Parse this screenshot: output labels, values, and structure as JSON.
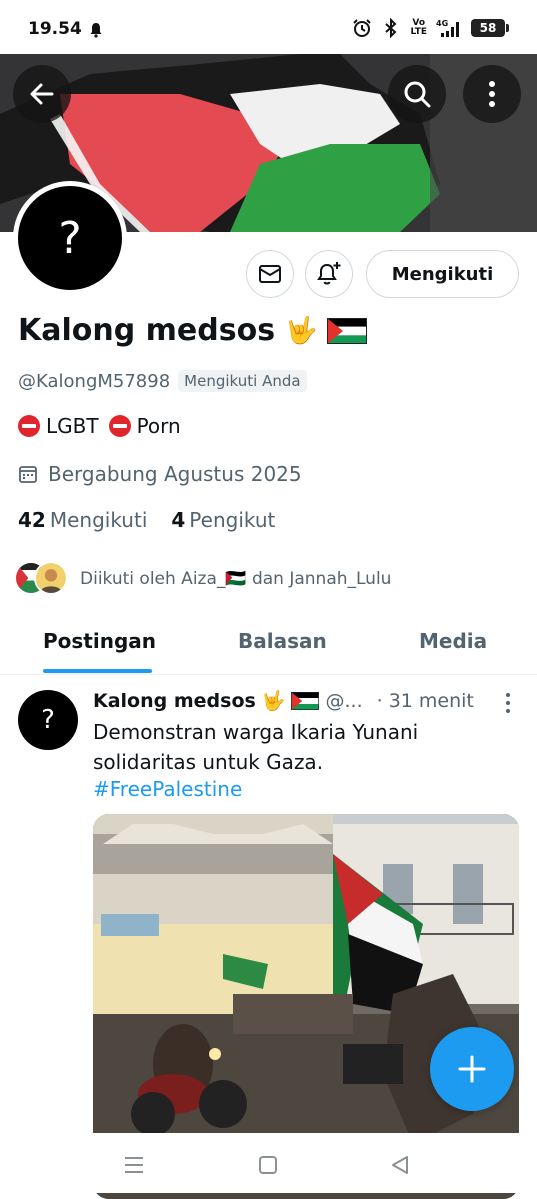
{
  "status_bar": {
    "time": "19.54",
    "volte_top": "Vo",
    "volte_bottom": "LTE",
    "network": "4G",
    "battery": "58",
    "icons": [
      "bell-icon",
      "alarm-icon",
      "bluetooth-icon",
      "volte-icon",
      "signal-icon",
      "battery-icon"
    ]
  },
  "header": {
    "back_icon": "arrow-left-icon",
    "search_icon": "search-icon",
    "more_icon": "more-vertical-icon"
  },
  "profile": {
    "avatar_glyph": "?",
    "display_name": "Kalong medsos",
    "name_emoji": "🤟",
    "handle": "@KalongM57898",
    "follows_you_badge": "Mengikuti Anda",
    "bio_part_1": "LGBT",
    "bio_part_2": "Porn",
    "joined": "Bergabung Agustus 2025",
    "following_count": "42",
    "following_label": "Mengikuti",
    "followers_count": "4",
    "followers_label": "Pengikut",
    "followed_by": "Diikuti oleh Aiza_🇵🇸 dan Jannah_Lulu"
  },
  "actions": {
    "follow_button": "Mengikuti",
    "message_icon": "mail-icon",
    "notify_icon": "bell-plus-icon"
  },
  "tabs": [
    {
      "label": "Postingan",
      "active": true
    },
    {
      "label": "Balasan",
      "active": false
    },
    {
      "label": "Media",
      "active": false
    }
  ],
  "post": {
    "author_name": "Kalong medsos",
    "author_emoji": "🤟",
    "author_handle": "@...",
    "time": "· 31 menit",
    "text": "Demonstran warga Ikaria Yunani solidaritas untuk Gaza.",
    "hashtag": "#FreePalestine"
  },
  "fab": {
    "icon": "plus-icon"
  },
  "nav": {
    "icons": [
      "menu-icon",
      "home-square-icon",
      "back-triangle-icon"
    ]
  },
  "colors": {
    "accent": "#1d9bf0",
    "secondary_text": "#536471",
    "primary_text": "#0f1419",
    "border": "#cfd9de"
  }
}
